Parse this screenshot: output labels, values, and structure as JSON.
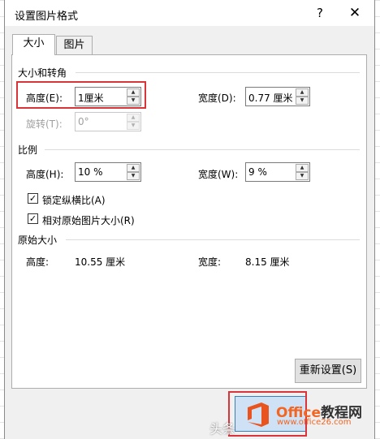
{
  "dialog": {
    "title": "设置图片格式",
    "help_label": "?",
    "close_label": "✕"
  },
  "tabs": [
    {
      "label": "大小",
      "active": true
    },
    {
      "label": "图片",
      "active": false
    }
  ],
  "size_rotate": {
    "heading": "大小和转角",
    "height_label": "高度(E):",
    "height_value": "1厘米",
    "width_label": "宽度(D):",
    "width_value": "0.77 厘米",
    "rotate_label": "旋转(T):",
    "rotate_value": "0°"
  },
  "scale": {
    "heading": "比例",
    "height_label": "高度(H):",
    "height_value": "10 %",
    "width_label": "宽度(W):",
    "width_value": "9 %",
    "lock_aspect_label": "锁定纵横比(A)",
    "lock_aspect_checked": true,
    "relative_label": "相对原始图片大小(R)",
    "relative_checked": true
  },
  "original": {
    "heading": "原始大小",
    "height_label": "高度:",
    "height_value": "10.55 厘米",
    "width_label": "宽度:",
    "width_value": "8.15 厘米"
  },
  "buttons": {
    "reset_label": "重新设置(S)"
  },
  "watermark": {
    "source": "头条",
    "brand": "Office",
    "brand_suffix": "教程网",
    "url": "www.office26.com"
  },
  "colors": {
    "highlight": "#d9343a",
    "brand": "#f26522"
  }
}
